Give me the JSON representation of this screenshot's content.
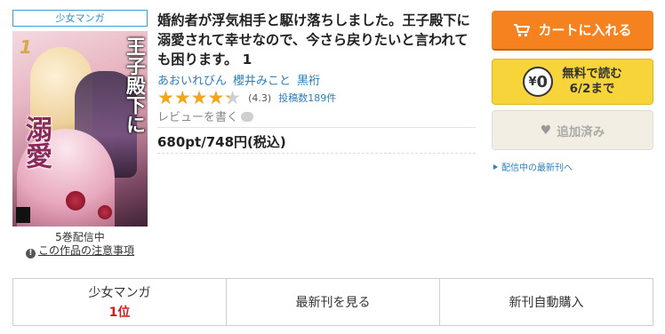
{
  "genre_badge": "少女マンガ",
  "cover": {
    "vertical_title": "王子殿下に",
    "volume": "1",
    "big_text": "溺愛",
    "alt_subtitle": "されて幸せなので、"
  },
  "delivery_count": "5巻配信中",
  "notice_link": "この作品の注意事項",
  "title": "婚約者が浮気相手と駆け落ちしました。王子殿下に溺愛されて幸せなので、今さら戻りたいと言われても困ります。 1",
  "authors": [
    "あおいれびん",
    "櫻井みこと",
    "黒裄"
  ],
  "rating": {
    "stars_filled_fraction": 0.86,
    "score_text": "(4.3)",
    "reviews_text": "投稿数189件"
  },
  "write_review": "レビューを書く",
  "price": "680pt/748円(税込)",
  "buttons": {
    "cart": "カートに入れる",
    "free_yen": "¥",
    "free_zero": "0",
    "free_line1": "無料で読む",
    "free_line2": "6/2まで",
    "added": "追加済み"
  },
  "latest_link": "配信中の最新刊へ",
  "bottom": {
    "genre": "少女マンガ",
    "rank": "1位",
    "latest": "最新刊を見る",
    "auto_buy": "新刊自動購入"
  },
  "colors": {
    "accent_orange": "#f5821f",
    "free_yellow": "#f7d43a",
    "link_blue": "#2a7fbf",
    "star": "#f2a619",
    "rank_red": "#d01c1c"
  }
}
